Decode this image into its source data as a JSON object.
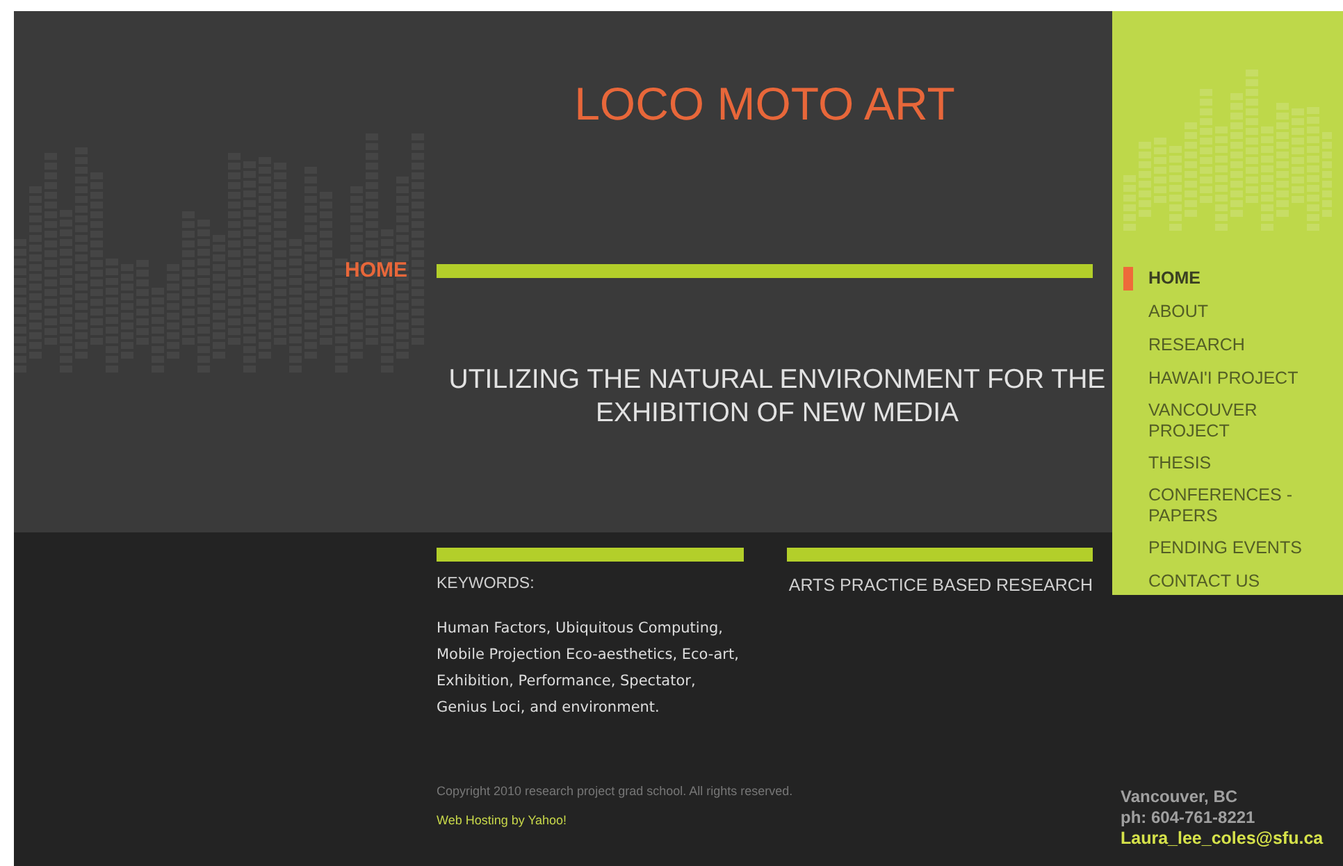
{
  "site_title": "LOCO MOTO ART",
  "current_page": "HOME",
  "tagline": "UTILIZING THE NATURAL ENVIRONMENT FOR THE EXHIBITION OF NEW MEDIA",
  "nav": [
    {
      "label": "HOME",
      "selected": true
    },
    {
      "label": "ABOUT",
      "selected": false
    },
    {
      "label": "RESEARCH",
      "selected": false
    },
    {
      "label": "HAWAI'I PROJECT",
      "selected": false
    },
    {
      "label": "VANCOUVER PROJECT",
      "selected": false
    },
    {
      "label": "THESIS",
      "selected": false
    },
    {
      "label": "CONFERENCES - PAPERS",
      "selected": false
    },
    {
      "label": "PENDING EVENTS",
      "selected": false
    },
    {
      "label": "CONTACT US",
      "selected": false
    }
  ],
  "keywords": {
    "heading": "KEYWORDS:",
    "text": "Human Factors, Ubiquitous Computing, Mobile Projection  Eco-aesthetics, Eco-art, Exhibition,  Performance, Spectator, Genius Loci, and environment."
  },
  "research": {
    "heading": "ARTS PRACTICE BASED RESEARCH"
  },
  "footer": {
    "copyright": "Copyright 2010 research project grad school. All rights reserved.",
    "hosting_link": "Web Hosting by Yahoo!"
  },
  "contact": {
    "city": "Vancouver, BC",
    "phone": "ph: 604-761-8221",
    "email": "Laura_lee_coles@sfu.ca"
  }
}
